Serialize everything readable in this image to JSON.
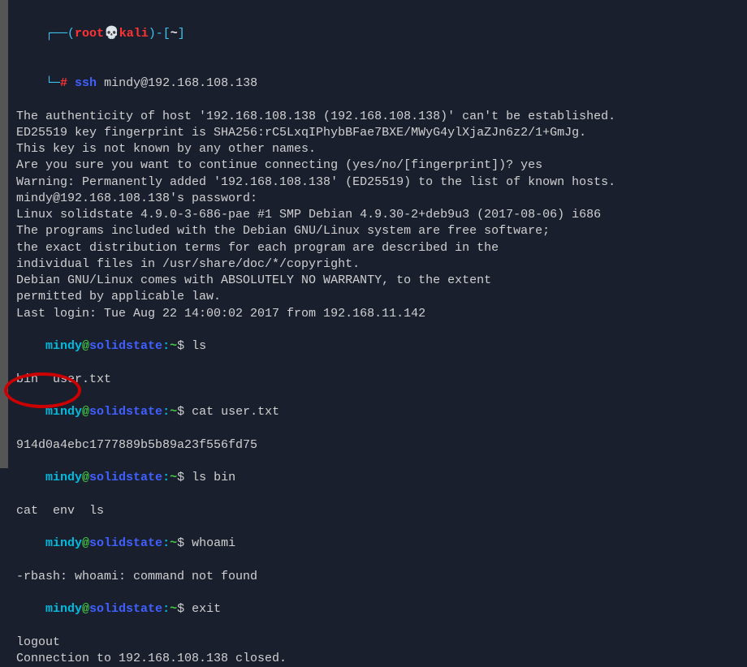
{
  "prompt1": {
    "line1_box": "┌──(",
    "user": "root",
    "skull": "💀",
    "host": "kali",
    "line1_end": ")-[",
    "cwd": "~",
    "close": "]",
    "line2_box": "└─",
    "hash": "#",
    "cmd_label": " ssh",
    "cmd_args": " mindy@192.168.108.138"
  },
  "ssh_output": [
    "The authenticity of host '192.168.108.138 (192.168.108.138)' can't be established.",
    "ED25519 key fingerprint is SHA256:rC5LxqIPhybBFae7BXE/MWyG4ylXjaZJn6z2/1+GmJg.",
    "This key is not known by any other names.",
    "Are you sure you want to continue connecting (yes/no/[fingerprint])? yes",
    "Warning: Permanently added '192.168.108.138' (ED25519) to the list of known hosts.",
    "mindy@192.168.108.138's password:",
    "Linux solidstate 4.9.0-3-686-pae #1 SMP Debian 4.9.30-2+deb9u3 (2017-08-06) i686",
    "",
    "The programs included with the Debian GNU/Linux system are free software;",
    "the exact distribution terms for each program are described in the",
    "individual files in /usr/share/doc/*/copyright.",
    "",
    "Debian GNU/Linux comes with ABSOLUTELY NO WARRANTY, to the extent",
    "permitted by applicable law.",
    "Last login: Tue Aug 22 14:00:02 2017 from 192.168.11.142"
  ],
  "sessions": [
    {
      "cmd": " ls",
      "out": [
        "bin  user.txt"
      ]
    },
    {
      "cmd": " cat user.txt",
      "out": [
        "914d0a4ebc1777889b5b89a23f556fd75"
      ]
    },
    {
      "cmd": " ls bin",
      "out": [
        "cat  env  ls"
      ]
    },
    {
      "cmd": " whoami",
      "out": [
        "-rbash: whoami: command not found"
      ]
    },
    {
      "cmd": " exit",
      "out": [
        "logout",
        "Connection to 192.168.108.138 closed."
      ]
    }
  ],
  "remote_prompt": {
    "user": "mindy",
    "at": "@",
    "host": "solidstate",
    "colon": ":",
    "cwd": "~",
    "dollar": "$"
  }
}
